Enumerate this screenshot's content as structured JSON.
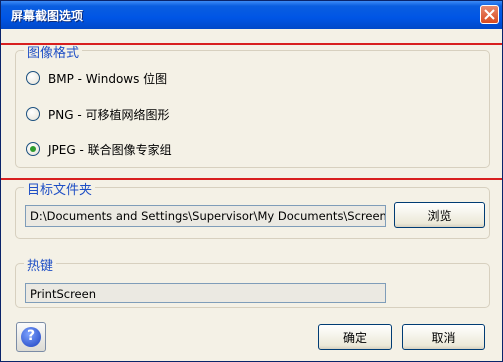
{
  "window": {
    "title": "屏幕截图选项"
  },
  "image_format": {
    "legend": "图像格式",
    "options": [
      {
        "label": "BMP - Windows 位图",
        "selected": false
      },
      {
        "label": "PNG - 可移植网络图形",
        "selected": false
      },
      {
        "label": "JPEG - 联合图像专家组",
        "selected": true
      }
    ]
  },
  "target_folder": {
    "legend": "目标文件夹",
    "path": "D:\\Documents and Settings\\Supervisor\\My Documents\\Screen Snap",
    "browse_label": "浏览"
  },
  "hotkey": {
    "legend": "热键",
    "value": "PrintScreen"
  },
  "footer": {
    "ok_label": "确定",
    "cancel_label": "取消",
    "help_symbol": "?"
  },
  "colors": {
    "title_bar": "#0055e5",
    "legend_text": "#1f4fc5",
    "annotation_line": "#d81f1f",
    "selected_radio": "#2e9c2e"
  }
}
